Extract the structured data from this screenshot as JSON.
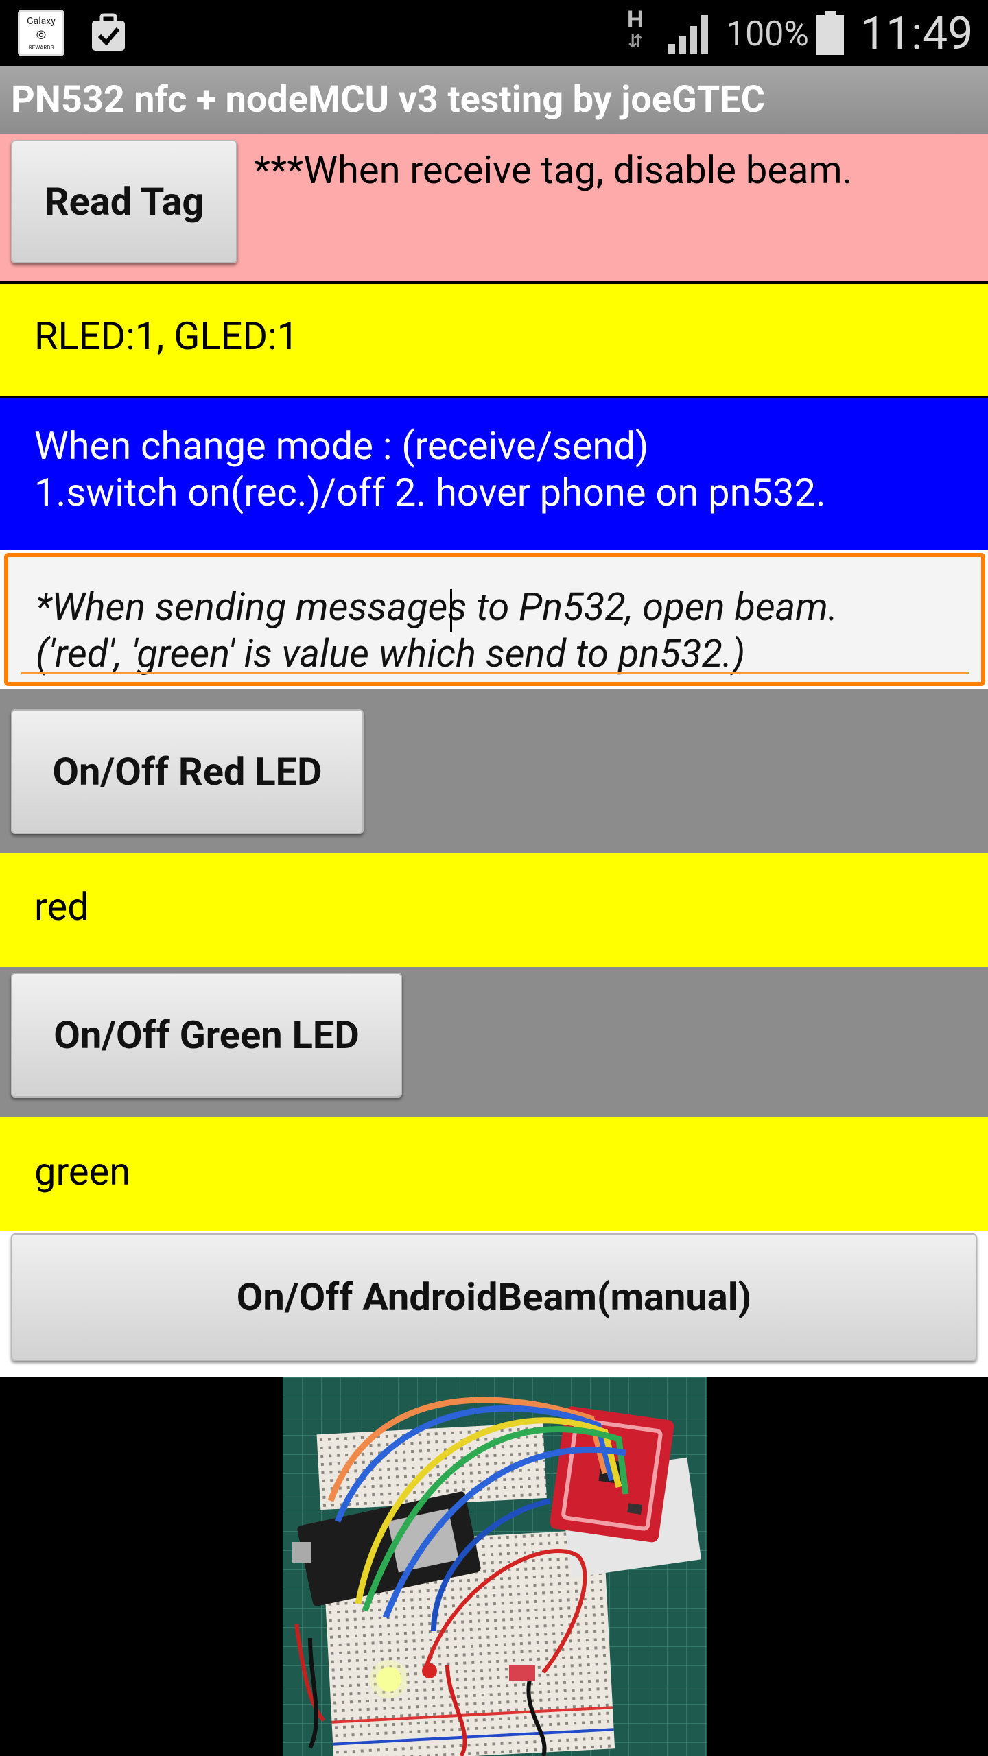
{
  "status_bar": {
    "galaxy_line1": "Galaxy",
    "galaxy_line2": "⦾",
    "galaxy_line3": "REWARDS",
    "network": "H",
    "battery_percent": "100%",
    "time": "11:49",
    "icons": [
      "galaxy-rewards-icon",
      "clipboard-check-icon",
      "network-h-icon",
      "signal-icon",
      "battery-icon"
    ]
  },
  "app": {
    "title": "PN532 nfc + nodeMCU v3  testing by joeGTEC"
  },
  "read_tag": {
    "button_label": "Read Tag",
    "note": "***When receive tag, disable beam.",
    "bg": "#ffaaaa"
  },
  "led_status": {
    "text": "RLED:1, GLED:1",
    "bg": "#ffff00"
  },
  "mode_info": {
    "line1": "When change mode : (receive/send)",
    "line2": "1.switch on(rec.)/off 2. hover phone on pn532.",
    "bg": "#0000ff"
  },
  "message_input": {
    "line1": "*When sending messages to Pn532, open beam.",
    "line2": "('red', 'green' is value which send to pn532.)",
    "focus_color": "#ff8000"
  },
  "red_led": {
    "button_label": "On/Off Red LED",
    "value": "red"
  },
  "green_led": {
    "button_label": "On/Off Green LED",
    "value": "green"
  },
  "beam": {
    "button_label": "On/Off AndroidBeam(manual)"
  },
  "photo": {
    "icon": "breadboard-photo"
  }
}
